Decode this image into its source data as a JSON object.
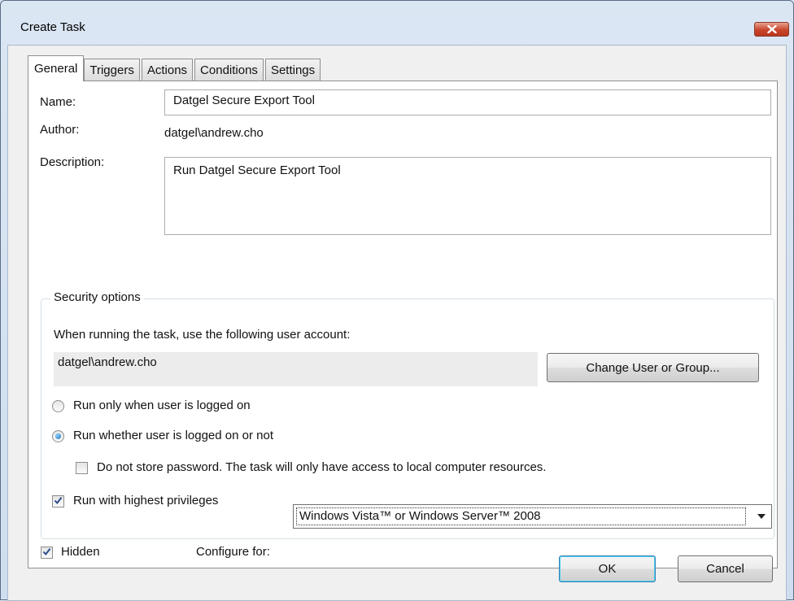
{
  "window": {
    "title": "Create Task"
  },
  "tabs": [
    "General",
    "Triggers",
    "Actions",
    "Conditions",
    "Settings"
  ],
  "general": {
    "name_label": "Name:",
    "name_value": "Datgel Secure Export Tool",
    "author_label": "Author:",
    "author_value": "datgel\\andrew.cho",
    "description_label": "Description:",
    "description_value": "Run Datgel Secure Export Tool"
  },
  "security": {
    "group_title": "Security options",
    "account_prompt": "When running the task, use the following user account:",
    "account_value": "datgel\\andrew.cho",
    "change_button": "Change User or Group...",
    "radio_logged_on": "Run only when user is logged on",
    "radio_whether": "Run whether user is logged on or not",
    "selected_radio": "radio_whether",
    "no_store_password": "Do not store password.  The task will only have access to local computer resources.",
    "no_store_password_checked": false,
    "highest_privileges": "Run with highest privileges",
    "highest_privileges_checked": true
  },
  "footer": {
    "hidden_label": "Hidden",
    "hidden_checked": true,
    "configure_label": "Configure for:",
    "configure_value": "Windows Vista™ or Windows Server™ 2008"
  },
  "buttons": {
    "ok": "OK",
    "cancel": "Cancel"
  }
}
